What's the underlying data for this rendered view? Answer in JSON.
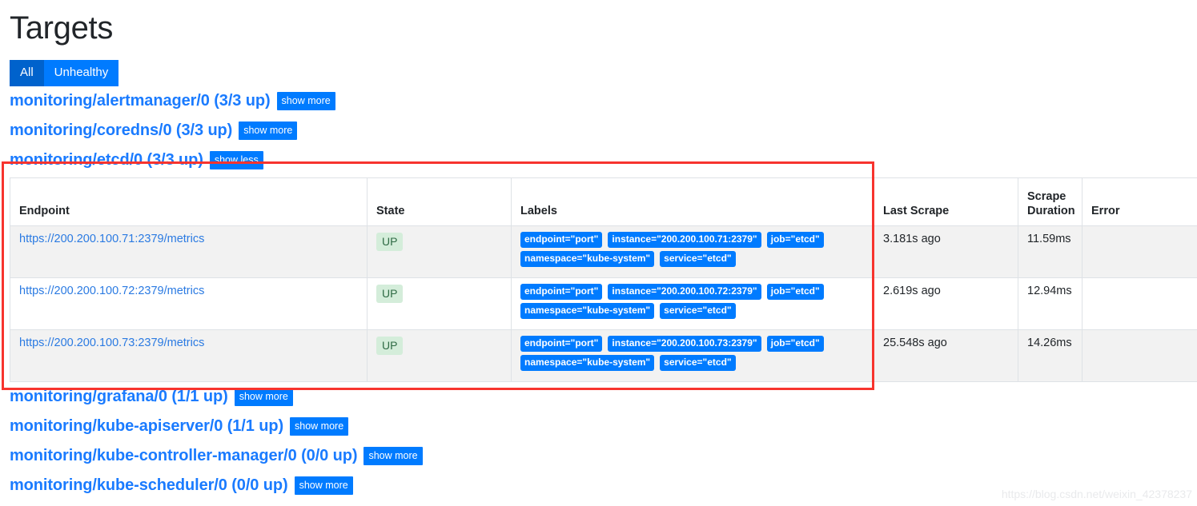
{
  "page": {
    "title": "Targets",
    "watermark": "https://blog.csdn.net/weixin_42378237"
  },
  "filters": {
    "all_label": "All",
    "unhealthy_label": "Unhealthy",
    "active": "All"
  },
  "labels_text": {
    "show_more": "show more",
    "show_less": "show less"
  },
  "jobs_before": [
    {
      "name": "monitoring/alertmanager/0 (3/3 up)",
      "toggle": "show more"
    },
    {
      "name": "monitoring/coredns/0 (3/3 up)",
      "toggle": "show more"
    }
  ],
  "expanded_job": {
    "name": "monitoring/etcd/0 (3/3 up)",
    "toggle": "show less",
    "table": {
      "headers": {
        "endpoint": "Endpoint",
        "state": "State",
        "labels": "Labels",
        "last_scrape": "Last Scrape",
        "scrape_duration": "Scrape Duration",
        "error": "Error"
      },
      "rows": [
        {
          "endpoint": "https://200.200.100.71:2379/metrics",
          "state": "UP",
          "labels": [
            "endpoint=\"port\"",
            "instance=\"200.200.100.71:2379\"",
            "job=\"etcd\"",
            "namespace=\"kube-system\"",
            "service=\"etcd\""
          ],
          "last_scrape": "3.181s ago",
          "scrape_duration": "11.59ms",
          "error": ""
        },
        {
          "endpoint": "https://200.200.100.72:2379/metrics",
          "state": "UP",
          "labels": [
            "endpoint=\"port\"",
            "instance=\"200.200.100.72:2379\"",
            "job=\"etcd\"",
            "namespace=\"kube-system\"",
            "service=\"etcd\""
          ],
          "last_scrape": "2.619s ago",
          "scrape_duration": "12.94ms",
          "error": ""
        },
        {
          "endpoint": "https://200.200.100.73:2379/metrics",
          "state": "UP",
          "labels": [
            "endpoint=\"port\"",
            "instance=\"200.200.100.73:2379\"",
            "job=\"etcd\"",
            "namespace=\"kube-system\"",
            "service=\"etcd\""
          ],
          "last_scrape": "25.548s ago",
          "scrape_duration": "14.26ms",
          "error": ""
        }
      ]
    }
  },
  "jobs_after": [
    {
      "name": "monitoring/grafana/0 (1/1 up)",
      "toggle": "show more"
    },
    {
      "name": "monitoring/kube-apiserver/0 (1/1 up)",
      "toggle": "show more"
    },
    {
      "name": "monitoring/kube-controller-manager/0 (0/0 up)",
      "toggle": "show more"
    },
    {
      "name": "monitoring/kube-scheduler/0 (0/0 up)",
      "toggle": "show more"
    }
  ],
  "colors": {
    "primary_blue": "#007bff",
    "active_blue": "#0062cc",
    "link_blue": "#1a7bff",
    "up_badge_bg": "#d4edda",
    "up_badge_fg": "#2f6b45",
    "highlight_red": "#f7342e"
  }
}
